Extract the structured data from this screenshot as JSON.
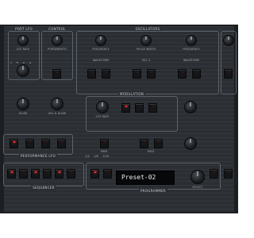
{
  "sections": {
    "port_lfo": "PORT LFO",
    "control": "CONTROL",
    "oscillators": "OSCILLATORS",
    "modulation": "MODULATION",
    "performance_lfo": "PERFORMANCE LFO",
    "sequencer": "SEQUENCER",
    "programmer": "PROGRAMMER"
  },
  "labels": {
    "lfo_rate": "LFO RATE",
    "portamento": "PORTAMENTO",
    "frequency": "FREQUENCY",
    "pulse_width": "PULSE WIDTH",
    "waveform": "WAVEFORM",
    "osc2": "OSC 2",
    "lfo_rate_2": "LFO RATE",
    "pwm": "PWM",
    "mod": "MOD",
    "select": "SELECT",
    "glide": "GLIDE",
    "vol_glide": "VOL & GLIDE",
    "ctrl_labels": [
      "1/4",
      "1/8",
      "1/16"
    ]
  },
  "display": {
    "preset": "Preset-02"
  },
  "colors": {
    "panel": "#2b2f34",
    "led_on": "#ff2a2a",
    "screen": "#070809",
    "text": "#e9edf0"
  }
}
